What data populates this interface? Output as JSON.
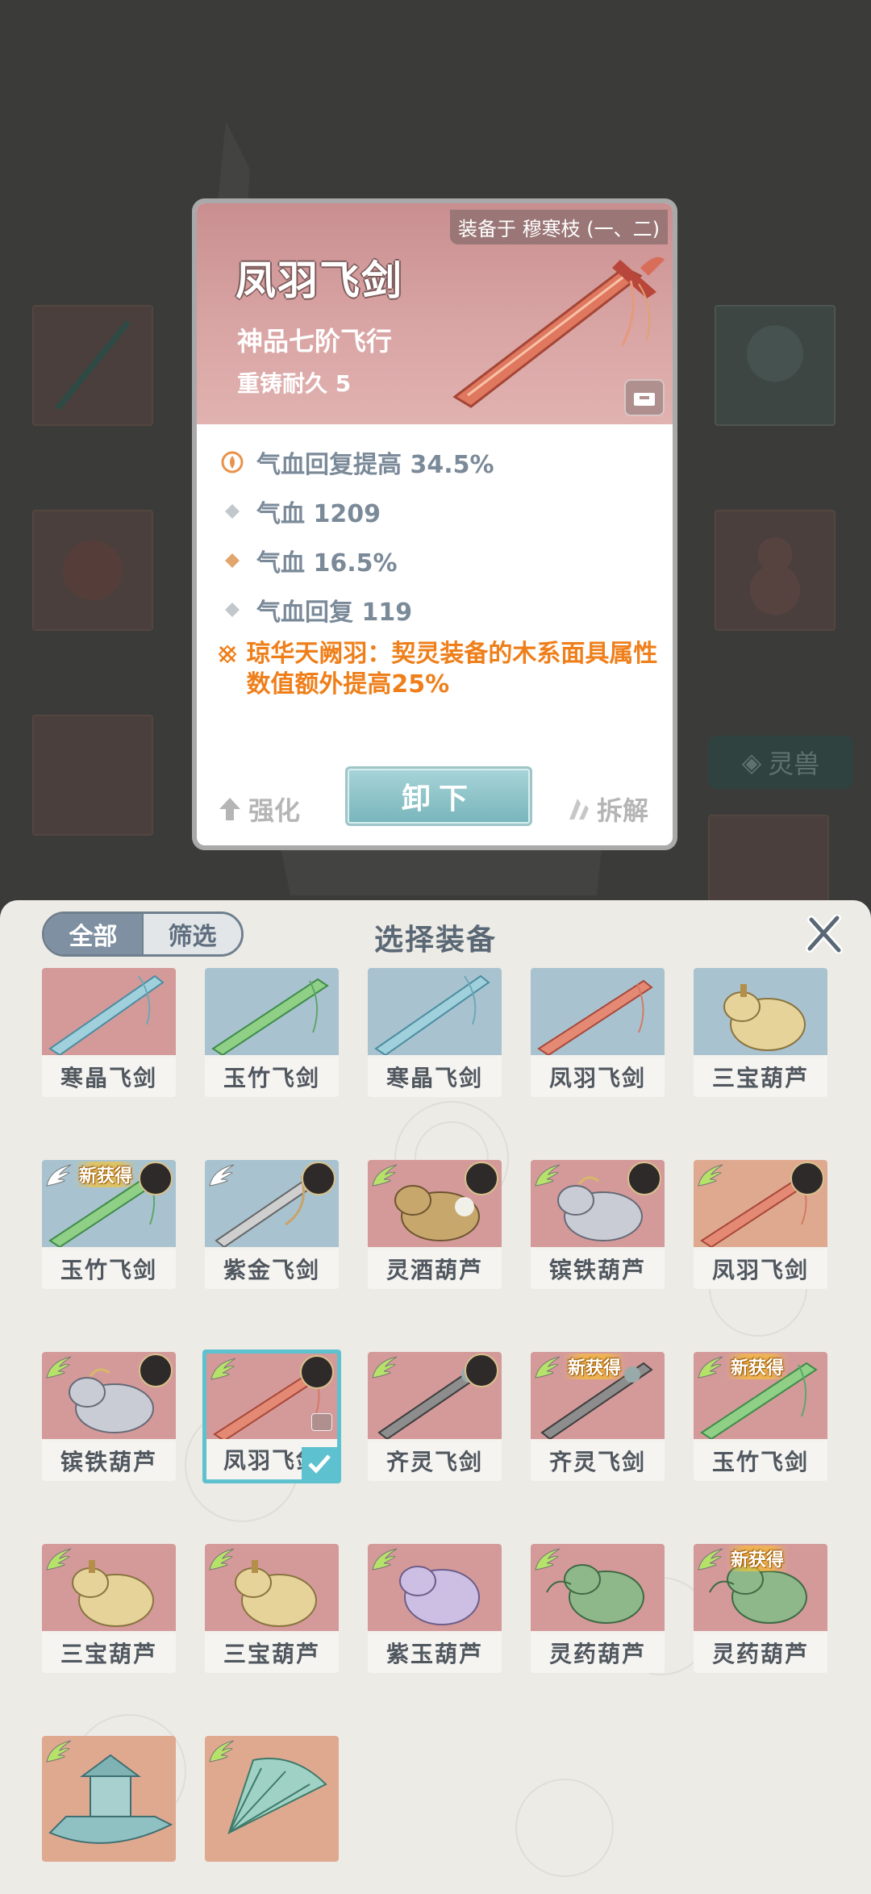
{
  "background": {
    "side_menu_label": "灵兽"
  },
  "detail": {
    "equipped_by": "装备于 穆寒枝 (一、二)",
    "title": "凤羽飞剑",
    "grade": "神品七阶飞行",
    "durability": "重铸耐久 5",
    "stats": [
      {
        "icon": "flame-main-stat-icon",
        "text": "气血回复提高 34.5%"
      },
      {
        "icon": "grey-diamond-icon",
        "text": "气血 1209"
      },
      {
        "icon": "orange-diamond-icon",
        "text": "气血 16.5%"
      },
      {
        "icon": "grey-diamond-icon",
        "text": "气血回复 119"
      }
    ],
    "special": "琼华天阙羽：契灵装备的木系面具属性数值额外提高25%",
    "upgrade_label": "强化",
    "unequip_label": "卸下",
    "dismantle_label": "拆解"
  },
  "panel": {
    "toggle_all": "全部",
    "toggle_filter": "筛选",
    "title": "选择装备",
    "new_label": "新获得",
    "items": [
      {
        "name": "寒晶飞剑",
        "bg": "pink",
        "type": "blade-blue"
      },
      {
        "name": "玉竹飞剑",
        "bg": "blue",
        "type": "blade-green"
      },
      {
        "name": "寒晶飞剑",
        "bg": "blue",
        "type": "blade-blue"
      },
      {
        "name": "凤羽飞剑",
        "bg": "blue",
        "type": "blade-red"
      },
      {
        "name": "三宝葫芦",
        "bg": "blue",
        "type": "gourd-gold"
      },
      {
        "name": "玉竹飞剑",
        "bg": "blue",
        "type": "blade-green",
        "new": true,
        "avatar": true,
        "wing": "white"
      },
      {
        "name": "紫金飞剑",
        "bg": "blue",
        "type": "blade-gold",
        "avatar": true,
        "wing": "white"
      },
      {
        "name": "灵酒葫芦",
        "bg": "pink",
        "type": "gourd-brown",
        "avatar": true,
        "wing": "green"
      },
      {
        "name": "镔铁葫芦",
        "bg": "pink",
        "type": "gourd-silver",
        "avatar": true,
        "wing": "green"
      },
      {
        "name": "凤羽飞剑",
        "bg": "peach",
        "type": "blade-red",
        "avatar": true,
        "wing": "green"
      },
      {
        "name": "镔铁葫芦",
        "bg": "pink",
        "type": "gourd-silver",
        "avatar": true,
        "wing": "green"
      },
      {
        "name": "凤羽飞剑",
        "bg": "pink",
        "type": "blade-red",
        "avatar": true,
        "wing": "green",
        "selected": true
      },
      {
        "name": "齐灵飞剑",
        "bg": "pink",
        "type": "blade-dark",
        "avatar": true,
        "wing": "green"
      },
      {
        "name": "齐灵飞剑",
        "bg": "pink",
        "type": "blade-dark",
        "new": true,
        "wing": "green"
      },
      {
        "name": "玉竹飞剑",
        "bg": "pink",
        "type": "blade-green",
        "new": true,
        "wing": "green"
      },
      {
        "name": "三宝葫芦",
        "bg": "pink",
        "type": "gourd-gold",
        "wing": "green"
      },
      {
        "name": "三宝葫芦",
        "bg": "pink",
        "type": "gourd-gold",
        "wing": "green"
      },
      {
        "name": "紫玉葫芦",
        "bg": "pink",
        "type": "gourd-purple",
        "wing": "green"
      },
      {
        "name": "灵药葫芦",
        "bg": "pink",
        "type": "gourd-jade",
        "wing": "green"
      },
      {
        "name": "灵药葫芦",
        "bg": "pink",
        "type": "gourd-jade",
        "new": true,
        "wing": "green"
      },
      {
        "name": "",
        "bg": "peach",
        "type": "boat",
        "wing": "green"
      },
      {
        "name": "",
        "bg": "peach",
        "type": "fan",
        "wing": "green"
      }
    ]
  },
  "colors": {
    "accent_teal": "#5ec1cf",
    "special_orange": "#ef7f1a",
    "stat_grey": "#7b8a99"
  }
}
